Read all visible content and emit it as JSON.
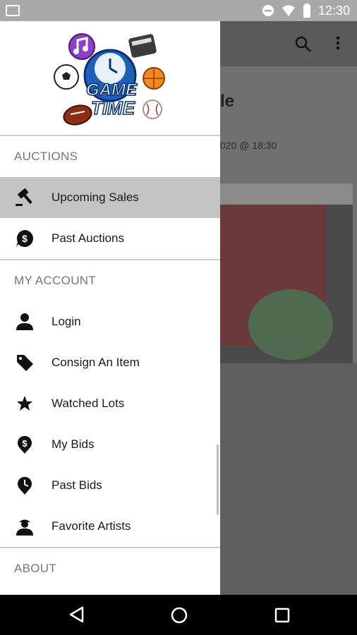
{
  "status_bar": {
    "time": "12:30"
  },
  "background": {
    "title_fragment": "le",
    "date_fragment": "020 @ 18:30"
  },
  "logo": {
    "line1": "GAME",
    "line2": "TIME"
  },
  "drawer": {
    "sections": [
      {
        "label": "AUCTIONS",
        "items": [
          {
            "label": "Upcoming Sales",
            "icon": "gavel-icon",
            "active": true
          },
          {
            "label": "Past Auctions",
            "icon": "dollar-bubble-icon",
            "active": false
          }
        ]
      },
      {
        "label": "MY ACCOUNT",
        "items": [
          {
            "label": "Login",
            "icon": "person-icon"
          },
          {
            "label": "Consign An Item",
            "icon": "tag-icon"
          },
          {
            "label": "Watched Lots",
            "icon": "star-icon"
          },
          {
            "label": "My Bids",
            "icon": "dollar-pin-icon"
          },
          {
            "label": "Past Bids",
            "icon": "clock-pin-icon"
          },
          {
            "label": "Favorite Artists",
            "icon": "artist-icon"
          }
        ]
      },
      {
        "label": "ABOUT"
      }
    ]
  },
  "colors": {
    "active_item_bg": "#c4c4c4",
    "section_label": "#757575",
    "logo_blue": "#1e5fb8"
  }
}
